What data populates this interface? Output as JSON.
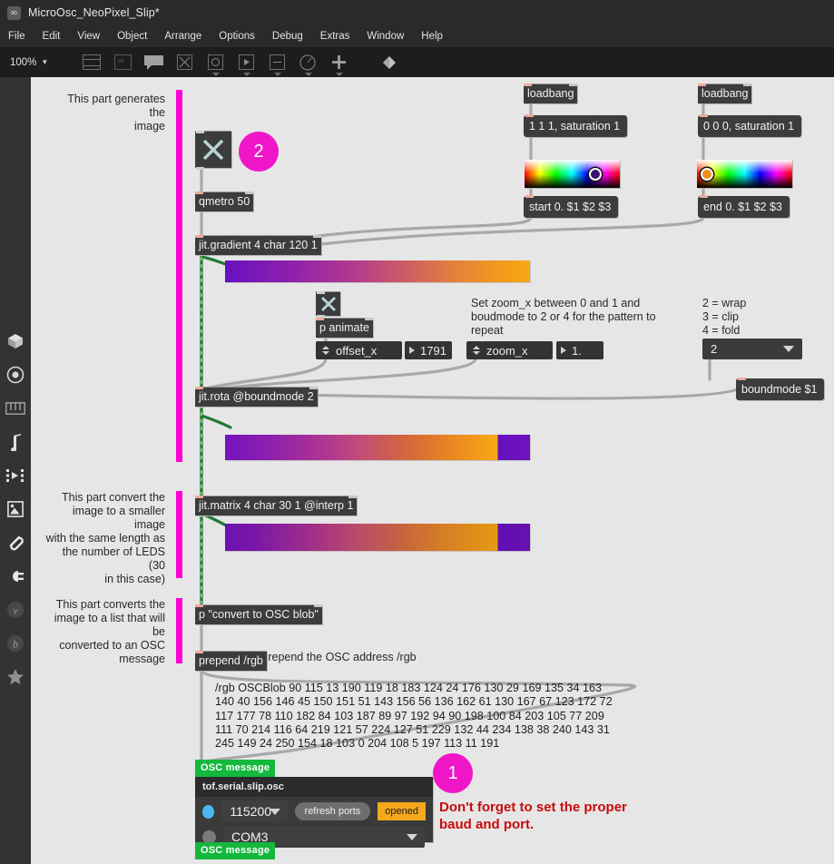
{
  "window": {
    "title": "MicroOsc_NeoPixel_Slip*",
    "app_icon": "max-icon"
  },
  "menu": {
    "items": [
      "File",
      "Edit",
      "View",
      "Object",
      "Arrange",
      "Options",
      "Debug",
      "Extras",
      "Window",
      "Help"
    ]
  },
  "toolbar": {
    "zoom": "100%",
    "zoom_caret": "▼",
    "icons": [
      {
        "name": "inspector-icon"
      },
      {
        "name": "message-box-icon"
      },
      {
        "name": "comment-icon"
      },
      {
        "name": "toggle-icon"
      },
      {
        "name": "button-icon"
      },
      {
        "name": "slider-icon"
      },
      {
        "name": "number-box-icon"
      },
      {
        "name": "dial-icon"
      },
      {
        "name": "add-object-icon"
      },
      {
        "name": "paint-bucket-icon"
      }
    ]
  },
  "sidebar": {
    "icons": [
      {
        "name": "cube-icon"
      },
      {
        "name": "target-icon"
      },
      {
        "name": "keyboard-icon"
      },
      {
        "name": "music-note-icon"
      },
      {
        "name": "clip-grid-icon"
      },
      {
        "name": "image-icon"
      },
      {
        "name": "paperclip-icon"
      },
      {
        "name": "plug-icon"
      },
      {
        "name": "vizzie-icon"
      },
      {
        "name": "beap-icon"
      },
      {
        "name": "star-icon"
      }
    ]
  },
  "annotations": {
    "section1": "This part generates the\nimage",
    "section2": "This part convert the\nimage to a smaller image\nwith the same length as\nthe number of LEDS (30\nin this case)",
    "section3": "This part converts the\nimage to a list that will be\nconverted to an OSC\nmessage",
    "zoom_hint": "Set zoom_x between 0 and 1 and\nboudmode to 2 or 4 for the pattern to\nrepeat",
    "boundmode_legend": "2 = wrap\n3 = clip\n4 = fold",
    "prepend_hint": "Prepend the OSC address /rgb",
    "warning": "Don't forget to set the\nproper baud and port."
  },
  "badges": {
    "step1": "1",
    "step2": "2"
  },
  "objects": {
    "loadbang_left": "loadbang",
    "loadbang_right": "loadbang",
    "msg_start_color": "1 1 1, saturation 1",
    "msg_end_color": "0 0 0, saturation 1",
    "msg_start": "start 0. $1 $2 $3",
    "msg_end": "end 0. $1 $2 $3",
    "qmetro": "qmetro 50",
    "jit_gradient": "jit.gradient 4 char 120 1",
    "p_animate": "p animate",
    "jit_rota": "jit.rota @boundmode 2",
    "jit_matrix": "jit.matrix 4 char 30 1 @interp 1",
    "p_convert": "p \"convert to OSC blob\"",
    "prepend": "prepend /rgb",
    "msg_boundmode": "boundmode $1"
  },
  "controls": {
    "offset_x_label": "offset_x",
    "offset_x_value": "1791",
    "zoom_x_label": "zoom_x",
    "zoom_x_value": "1.",
    "boundmode_value": "2",
    "toggle_top_state": "on",
    "toggle_animate_state": "on"
  },
  "osc_blob": {
    "text": "/rgb OSCBlob 90 115 13 190 119 18 183 124 24 176 130 29 169 135 34 163 140 40 156 146 45 150 151 51 143 156 56 136 162 61 130 167 67 123 172 72 117 177 78 110 182 84 103 187 89 97 192 94 90 198 100 84 203 105 77 209 111 70 214 116 64 219 121 57 224 127 51 229 132 44 234 138 38 240 143 31 245 149 24 250 154 18 103 0 204 108 5 197 113 11 191"
  },
  "serial": {
    "tab_top": "OSC message",
    "tab_bottom": "OSC message",
    "title": "tof.serial.slip.osc",
    "baud": "115200",
    "refresh_label": "refresh ports",
    "status": "opened",
    "port": "COM3",
    "led_baud": "on",
    "led_port": "off"
  },
  "colors": {
    "accent_magenta": "#ff00d4",
    "badge_pink": "#ef16c8",
    "green_tab": "#14b83c",
    "warning_red": "#c90b0b",
    "status_orange": "#f5a81c",
    "gradient_start": "#6610c0",
    "gradient_end": "#f5a015",
    "object_bg": "#3c3c3c",
    "canvas_bg": "#e6e6e6",
    "chrome_bg": "#2a2a2a"
  }
}
